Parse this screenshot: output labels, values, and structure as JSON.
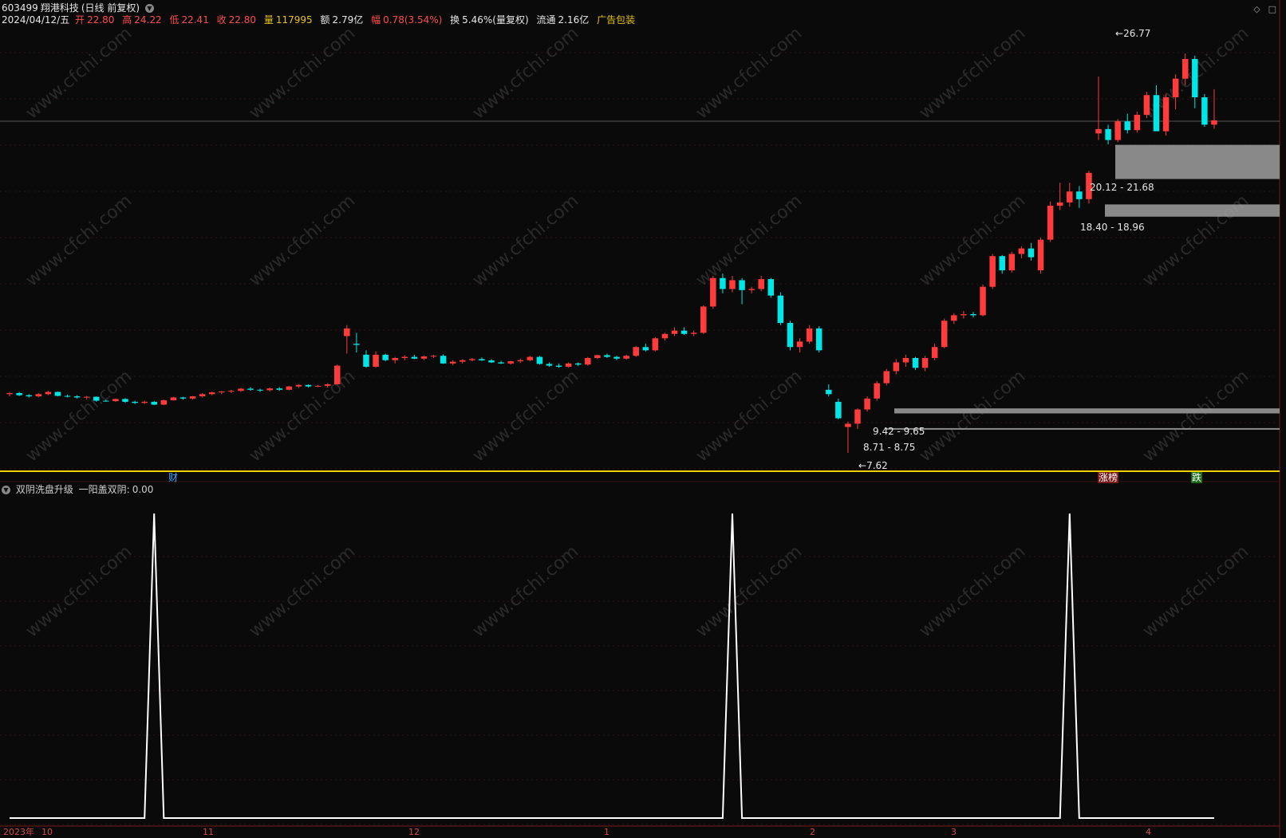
{
  "header": {
    "code": "603499",
    "name": "翔港科技",
    "period": "(日线 前复权)",
    "date": "2024/04/12/五",
    "open_label": "开",
    "open": "22.80",
    "high_label": "高",
    "high": "24.22",
    "low_label": "低",
    "low": "22.41",
    "close_label": "收",
    "close": "22.80",
    "vol_label": "量",
    "vol": "117995",
    "amount_label": "额",
    "amount": "2.79亿",
    "change_label": "幅",
    "change": "0.78(3.54%)",
    "turnover_label": "换",
    "turnover": "5.46%(量复权)",
    "float_label": "流通",
    "float": "2.16亿",
    "ad": "广告包装"
  },
  "window_icons": [
    "diamond-icon",
    "square-icon"
  ],
  "main_tags": {
    "cai": "财",
    "zhang": "涨榜",
    "die": "跌"
  },
  "zones": [
    {
      "label": "20.12 - 21.68",
      "low": 20.12,
      "high": 21.68
    },
    {
      "label": "18.40 - 18.96",
      "low": 18.4,
      "high": 18.96
    },
    {
      "label": "9.42 - 9.65",
      "low": 9.42,
      "high": 9.65
    },
    {
      "label": "8.71 - 8.75",
      "low": 8.71,
      "high": 8.75
    }
  ],
  "high_marker": "26.77",
  "low_marker": "7.62",
  "indicator": {
    "name": "双阴洗盘升级",
    "line_label": "一阳盖双阴:",
    "line_value": "0.00"
  },
  "time_axis": [
    "2023年",
    "10",
    "11",
    "12",
    "1",
    "2",
    "3",
    "4"
  ],
  "watermark": "www.cfchi.com",
  "colors": {
    "up": "#ff3b3b",
    "down": "#00e5e5",
    "bg": "#0a0a0a",
    "zone": "#a0a0a0",
    "divider": "#f0d000",
    "signal": "#ffffff"
  },
  "chart_data": {
    "type": "candlestick",
    "ylim": [
      7.0,
      28.0
    ],
    "candles": [
      [
        10.3,
        10.4,
        10.2,
        10.35
      ],
      [
        10.35,
        10.4,
        10.22,
        10.25
      ],
      [
        10.25,
        10.3,
        10.15,
        10.2
      ],
      [
        10.2,
        10.35,
        10.15,
        10.3
      ],
      [
        10.3,
        10.45,
        10.25,
        10.4
      ],
      [
        10.4,
        10.42,
        10.2,
        10.22
      ],
      [
        10.22,
        10.28,
        10.15,
        10.2
      ],
      [
        10.2,
        10.25,
        10.1,
        10.15
      ],
      [
        10.15,
        10.22,
        10.05,
        10.18
      ],
      [
        10.18,
        10.2,
        9.95,
        10.0
      ],
      [
        10.0,
        10.05,
        9.95,
        9.98
      ],
      [
        9.98,
        10.1,
        9.95,
        10.08
      ],
      [
        10.08,
        10.12,
        9.9,
        9.95
      ],
      [
        9.95,
        10.0,
        9.85,
        9.9
      ],
      [
        9.9,
        10.0,
        9.85,
        9.95
      ],
      [
        9.95,
        9.98,
        9.8,
        9.82
      ],
      [
        9.82,
        10.05,
        9.8,
        10.02
      ],
      [
        10.02,
        10.18,
        10.0,
        10.15
      ],
      [
        10.15,
        10.18,
        10.05,
        10.1
      ],
      [
        10.1,
        10.22,
        10.05,
        10.2
      ],
      [
        10.2,
        10.35,
        10.15,
        10.3
      ],
      [
        10.3,
        10.42,
        10.25,
        10.38
      ],
      [
        10.38,
        10.45,
        10.3,
        10.42
      ],
      [
        10.42,
        10.5,
        10.35,
        10.45
      ],
      [
        10.45,
        10.58,
        10.4,
        10.55
      ],
      [
        10.55,
        10.62,
        10.45,
        10.5
      ],
      [
        10.5,
        10.55,
        10.4,
        10.48
      ],
      [
        10.48,
        10.6,
        10.42,
        10.56
      ],
      [
        10.56,
        10.62,
        10.45,
        10.5
      ],
      [
        10.5,
        10.68,
        10.48,
        10.65
      ],
      [
        10.65,
        10.75,
        10.58,
        10.72
      ],
      [
        10.72,
        10.75,
        10.6,
        10.65
      ],
      [
        10.65,
        10.72,
        10.62,
        10.68
      ],
      [
        10.68,
        10.8,
        10.6,
        10.75
      ],
      [
        10.75,
        11.65,
        10.72,
        11.6
      ],
      [
        12.95,
        13.45,
        12.15,
        13.3
      ],
      [
        12.6,
        13.1,
        12.2,
        12.55
      ],
      [
        12.1,
        12.3,
        11.5,
        11.55
      ],
      [
        11.55,
        12.25,
        11.5,
        12.1
      ],
      [
        12.1,
        12.15,
        11.8,
        11.85
      ],
      [
        11.85,
        12.0,
        11.7,
        11.95
      ],
      [
        11.95,
        12.08,
        11.85,
        12.0
      ],
      [
        12.0,
        12.1,
        11.9,
        11.92
      ],
      [
        11.92,
        12.05,
        11.85,
        12.02
      ],
      [
        12.02,
        12.1,
        11.95,
        12.05
      ],
      [
        12.05,
        12.12,
        11.68,
        11.7
      ],
      [
        11.7,
        11.85,
        11.62,
        11.78
      ],
      [
        11.78,
        11.9,
        11.7,
        11.85
      ],
      [
        11.85,
        11.95,
        11.8,
        11.9
      ],
      [
        11.9,
        11.98,
        11.82,
        11.84
      ],
      [
        11.84,
        11.9,
        11.72,
        11.75
      ],
      [
        11.75,
        11.82,
        11.68,
        11.7
      ],
      [
        11.7,
        11.82,
        11.65,
        11.8
      ],
      [
        11.8,
        11.92,
        11.72,
        11.85
      ],
      [
        11.85,
        12.05,
        11.8,
        12.0
      ],
      [
        12.0,
        12.05,
        11.65,
        11.68
      ],
      [
        11.68,
        11.75,
        11.55,
        11.6
      ],
      [
        11.6,
        11.7,
        11.5,
        11.55
      ],
      [
        11.55,
        11.75,
        11.5,
        11.7
      ],
      [
        11.7,
        11.75,
        11.58,
        11.65
      ],
      [
        11.65,
        12.0,
        11.6,
        11.95
      ],
      [
        11.95,
        12.1,
        11.9,
        12.08
      ],
      [
        12.08,
        12.15,
        11.95,
        12.0
      ],
      [
        12.0,
        12.05,
        11.85,
        11.92
      ],
      [
        11.92,
        12.1,
        11.88,
        12.05
      ],
      [
        12.05,
        12.5,
        12.0,
        12.45
      ],
      [
        12.45,
        12.6,
        12.25,
        12.3
      ],
      [
        12.3,
        12.9,
        12.25,
        12.85
      ],
      [
        12.85,
        13.1,
        12.75,
        13.05
      ],
      [
        13.05,
        13.35,
        12.95,
        13.2
      ],
      [
        13.2,
        13.35,
        13.0,
        13.05
      ],
      [
        13.05,
        13.2,
        12.95,
        13.1
      ],
      [
        13.1,
        14.35,
        13.05,
        14.3
      ],
      [
        14.3,
        15.7,
        14.2,
        15.6
      ],
      [
        15.6,
        15.8,
        14.9,
        15.1
      ],
      [
        15.1,
        15.7,
        14.95,
        15.5
      ],
      [
        15.5,
        15.6,
        14.4,
        15.05
      ],
      [
        15.05,
        15.2,
        14.9,
        15.1
      ],
      [
        15.1,
        15.7,
        15.0,
        15.55
      ],
      [
        15.55,
        15.6,
        14.7,
        14.8
      ],
      [
        14.8,
        14.95,
        13.45,
        13.55
      ],
      [
        13.55,
        13.65,
        12.3,
        12.45
      ],
      [
        12.45,
        12.85,
        12.2,
        12.7
      ],
      [
        12.7,
        13.45,
        12.6,
        13.3
      ],
      [
        13.3,
        13.4,
        12.2,
        12.3
      ],
      [
        10.5,
        10.75,
        10.2,
        10.3
      ],
      [
        9.95,
        10.1,
        9.15,
        9.2
      ],
      [
        8.8,
        9.05,
        7.62,
        8.95
      ],
      [
        8.95,
        9.65,
        8.71,
        9.6
      ],
      [
        9.6,
        10.2,
        9.5,
        10.1
      ],
      [
        10.1,
        10.9,
        10.0,
        10.8
      ],
      [
        10.8,
        11.45,
        10.7,
        11.35
      ],
      [
        11.35,
        11.9,
        11.2,
        11.75
      ],
      [
        11.75,
        12.1,
        11.55,
        11.95
      ],
      [
        11.95,
        12.0,
        11.4,
        11.5
      ],
      [
        11.5,
        12.05,
        11.35,
        11.95
      ],
      [
        11.95,
        12.6,
        11.85,
        12.45
      ],
      [
        12.45,
        13.75,
        12.4,
        13.65
      ],
      [
        13.65,
        14.0,
        13.5,
        13.9
      ],
      [
        13.9,
        14.1,
        13.75,
        13.95
      ],
      [
        13.95,
        14.05,
        13.8,
        13.9
      ],
      [
        13.9,
        15.3,
        13.85,
        15.2
      ],
      [
        15.2,
        16.7,
        15.1,
        16.6
      ],
      [
        16.6,
        16.65,
        15.8,
        15.95
      ],
      [
        15.95,
        16.8,
        15.85,
        16.7
      ],
      [
        16.7,
        17.05,
        16.5,
        16.95
      ],
      [
        16.95,
        17.2,
        16.4,
        16.55
      ],
      [
        15.95,
        17.45,
        15.8,
        17.35
      ],
      [
        17.35,
        19.1,
        17.25,
        18.9
      ],
      [
        18.9,
        19.95,
        18.7,
        19.05
      ],
      [
        19.05,
        19.95,
        18.85,
        19.55
      ],
      [
        19.55,
        19.8,
        18.8,
        19.2
      ],
      [
        19.2,
        20.5,
        19.0,
        20.4
      ],
      [
        22.2,
        24.8,
        21.9,
        22.4
      ],
      [
        22.4,
        22.6,
        21.7,
        21.9
      ],
      [
        21.9,
        22.85,
        21.8,
        22.75
      ],
      [
        22.75,
        23.1,
        22.2,
        22.35
      ],
      [
        22.35,
        23.2,
        22.25,
        23.05
      ],
      [
        23.05,
        24.1,
        22.9,
        23.95
      ],
      [
        23.95,
        24.4,
        22.6,
        22.3
      ],
      [
        22.3,
        24.0,
        22.1,
        23.85
      ],
      [
        23.85,
        24.9,
        23.3,
        24.7
      ],
      [
        24.7,
        25.85,
        24.4,
        25.6
      ],
      [
        25.6,
        25.75,
        23.35,
        23.85
      ],
      [
        23.85,
        24.0,
        22.5,
        22.6
      ],
      [
        22.6,
        24.22,
        22.41,
        22.8
      ]
    ],
    "indicator_series": {
      "name": "一阳盖双阴",
      "ylim": [
        0,
        1
      ],
      "signal_indices": [
        15,
        75,
        110
      ],
      "values_note": "0 elsewhere, 1 at signal_indices"
    }
  }
}
